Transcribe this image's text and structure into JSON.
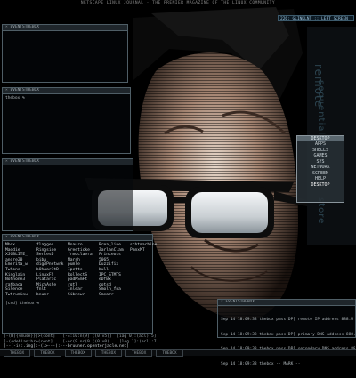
{
  "banner": "NETSCAPE LINUX JOURNAL - THE PREMIER MAGAZINE OF THE LINUX COMMUNITY",
  "status_top_right": "226: GLINKLNT :: LEFT SCREEN",
  "watermarks": [
    "remote",
    "sequential store",
    "store"
  ],
  "windows": {
    "top_left": {
      "title": "EVENTSTHEBOX"
    },
    "mid_left": {
      "title": "EVENTSTHEBOX",
      "line": "thebox %"
    },
    "mid_left2": {
      "title": "EVENTSTHEBOX"
    },
    "listing": {
      "title": "EVENTSTHEBOX",
      "columns": [
        [
          "Mbox",
          "Maddie",
          "XJOBLITE_",
          "andre20",
          "Emerita_w",
          "Twhone",
          "Kinglain",
          "Notnone3",
          "ratbaca",
          "Silence",
          "Twtruminu"
        ],
        [
          "flagged",
          "Ringside",
          "SerlesD",
          "bibu",
          "dig3Pnetwrk",
          "bOhuar1tD",
          "LinuxFS",
          "Plataric",
          "MichAshe",
          "fnlt",
          "bnumr"
        ],
        [
          "Mnauro",
          "Greeticke",
          "frmoclaera",
          "Marsh",
          "pumle",
          "Ipctte",
          "RollectS",
          "padMSmFt",
          "rgtl",
          "Inlear",
          "Sibnewr"
        ],
        [
          "Rrea_line",
          "ZarlanClam",
          "Frinceoss",
          "5065",
          "Duzzifix",
          "bull",
          "IPC_STMTS",
          "eDfBx",
          "ootsd",
          "Smoln_fna",
          "Smearr"
        ],
        [
          "",
          "",
          "schtmarbine",
          "",
          "",
          "",
          "",
          "",
          "",
          "",
          "PmnxMT"
        ]
      ],
      "cmd": "[csd] thebox %"
    },
    "log": {
      "title": "EVENTSTHEBOX",
      "lines": [
        "Sep 14 18:09:38 thebox pass[DP] remote IP address 888.U",
        "Sep 14 18:09:38 thebox pass[DP] primary DNS address 888.",
        "Sep 14 18:09:38 thebox pass[DP] secondary DNS address 888.",
        "Sep 14 18:09:38 thebox -- MARK --"
      ]
    }
  },
  "menu": {
    "title": "DESKTOP",
    "items": [
      "APPS",
      "SHELLS",
      "GAMES",
      "SYS",
      "NETWORK",
      "SCREEN",
      "HELP",
      "DESKTOP"
    ]
  },
  "bottom_lines": [
    "[-(H]{{muse}}[>(cont]   [-=:i0:n(9] ((0:v5)]  [iag 0]:(acl):5]",
    "[-(Adebian:br>(cont]    [-oc(9 nc(9 ((0 v0)    [log 1]:(acl):7",
    "[--[-i(:.ing]:-(1>---(:---bruuner.openterjacle.net]"
  ],
  "taskbar": [
    "THEBOX",
    "THEBOX",
    "THEBOX",
    "THEBOX",
    "THEBOX",
    "THEBOX"
  ]
}
